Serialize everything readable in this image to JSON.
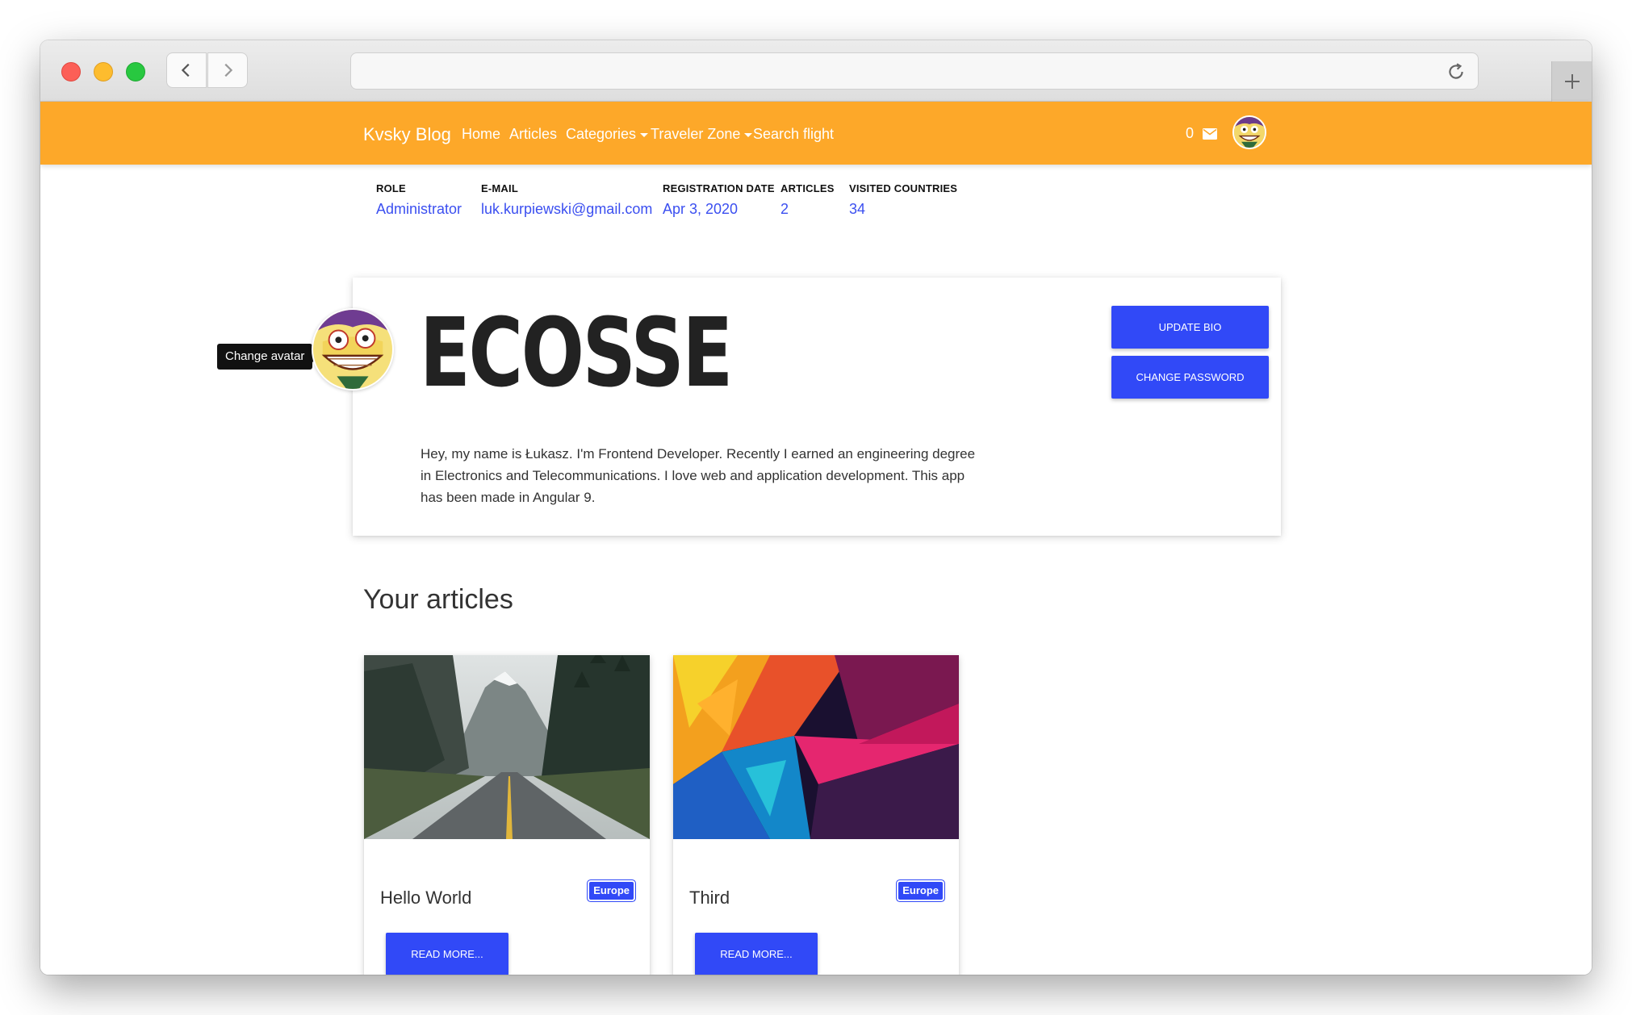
{
  "navbar": {
    "brand": "Kvsky Blog",
    "links": [
      "Home",
      "Articles",
      "Categories",
      "Traveler Zone",
      "Search flight"
    ],
    "message_count": "0"
  },
  "stats": [
    {
      "label": "ROLE",
      "value": "Administrator"
    },
    {
      "label": "E-MAIL",
      "value": "luk.kurpiewski@gmail.com"
    },
    {
      "label": "REGISTRATION DATE",
      "value": "Apr 3, 2020"
    },
    {
      "label": "ARTICLES",
      "value": "2"
    },
    {
      "label": "VISITED COUNTRIES",
      "value": "34"
    }
  ],
  "profile": {
    "username": "ECOSSE",
    "avatar_tooltip": "Change avatar",
    "bio": "Hey, my name is Łukasz. I'm Frontend Developer. Recently I earned an engineering degree in Electronics and Telecommunications. I love web and application development. This app has been made in Angular 9.",
    "update_bio_label": "UPDATE BIO",
    "change_password_label": "CHANGE PASSWORD"
  },
  "articles_section": {
    "title": "Your articles",
    "items": [
      {
        "title": "Hello World",
        "badge": "Europe",
        "button": "READ MORE..."
      },
      {
        "title": "Third",
        "badge": "Europe",
        "button": "READ MORE..."
      }
    ]
  },
  "colors": {
    "navbar": "#fda829",
    "primary": "#3149f7",
    "link": "#3b4ff0"
  }
}
